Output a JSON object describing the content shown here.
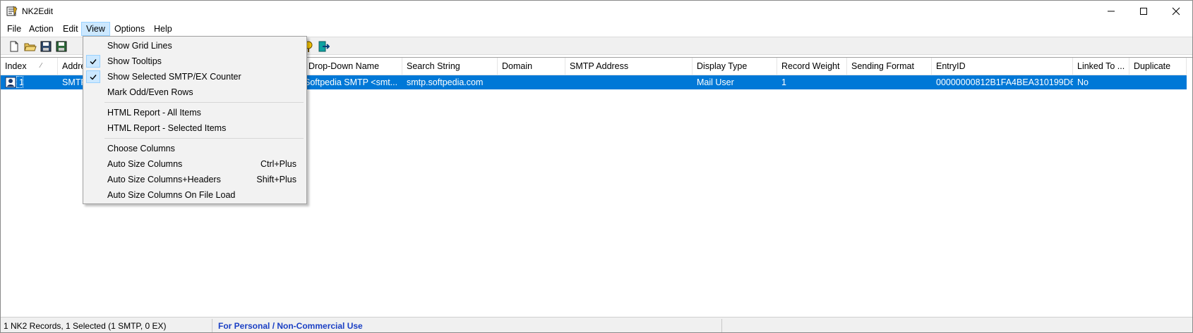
{
  "window": {
    "title": "NK2Edit"
  },
  "menubar": [
    "File",
    "Action",
    "Edit",
    "View",
    "Options",
    "Help"
  ],
  "columns": [
    {
      "label": "Index",
      "sorted": true
    },
    {
      "label": "Addre"
    },
    {
      "label": ""
    },
    {
      "label": "Drop-Down Name"
    },
    {
      "label": "Search String"
    },
    {
      "label": "Domain"
    },
    {
      "label": "SMTP Address"
    },
    {
      "label": "Display Type"
    },
    {
      "label": "Record Weight"
    },
    {
      "label": "Sending Format"
    },
    {
      "label": "EntryID"
    },
    {
      "label": "Linked To ..."
    },
    {
      "label": "Duplicate"
    }
  ],
  "rows": [
    {
      "index": "1",
      "address": "SMTP",
      "dropdown_name": "Softpedia SMTP  <smt...",
      "search_string": "smtp.softpedia.com",
      "domain": "",
      "smtp_address": "",
      "display_type": "Mail User",
      "record_weight": "1",
      "sending_format": "",
      "entry_id": "00000000812B1FA4BEA310199D6E...",
      "linked_to": "No",
      "duplicate": ""
    }
  ],
  "view_menu": {
    "items": [
      {
        "label": "Show Grid Lines",
        "checked": false,
        "shortcut": ""
      },
      {
        "label": "Show Tooltips",
        "checked": true,
        "shortcut": ""
      },
      {
        "label": "Show Selected SMTP/EX Counter",
        "checked": true,
        "shortcut": ""
      },
      {
        "label": "Mark Odd/Even Rows",
        "checked": false,
        "shortcut": ""
      },
      {
        "label": "HTML Report - All Items",
        "checked": false,
        "shortcut": ""
      },
      {
        "label": "HTML Report - Selected Items",
        "checked": false,
        "shortcut": ""
      },
      {
        "label": "Choose Columns",
        "checked": false,
        "shortcut": ""
      },
      {
        "label": "Auto Size Columns",
        "checked": false,
        "shortcut": "Ctrl+Plus"
      },
      {
        "label": "Auto Size Columns+Headers",
        "checked": false,
        "shortcut": "Shift+Plus"
      },
      {
        "label": "Auto Size Columns On File Load",
        "checked": false,
        "shortcut": ""
      }
    ]
  },
  "statusbar": {
    "records": "1 NK2 Records, 1 Selected  (1 SMTP,  0 EX)",
    "license": "For Personal / Non-Commercial Use"
  },
  "colors": {
    "selection": "#0078d7",
    "menu_highlight": "#cce8ff",
    "status_link": "#1a3fc4"
  }
}
